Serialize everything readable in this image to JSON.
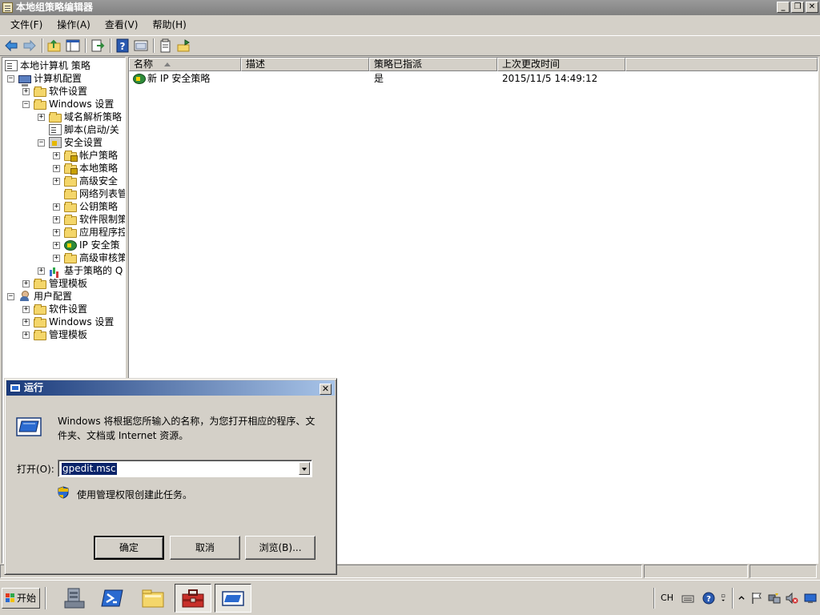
{
  "window": {
    "title": "本地组策略编辑器",
    "controls": {
      "minimize": "_",
      "maximize": "❐",
      "close": "✕"
    }
  },
  "menu": [
    "文件(F)",
    "操作(A)",
    "查看(V)",
    "帮助(H)"
  ],
  "toolbar_icons": [
    "back-icon",
    "forward-icon",
    "up-folder-icon",
    "show-hide-tree-icon",
    "export-list-icon",
    "help-icon",
    "console-icon",
    "properties-icon",
    "action-icon"
  ],
  "tree": {
    "root": "本地计算机 策略",
    "computer_config": "计算机配置",
    "software_settings": "软件设置",
    "windows_settings": "Windows 设置",
    "name_resolution": "域名解析策略",
    "scripts": "脚本(启动/关",
    "security_settings": "安全设置",
    "account_policy": "帐户策略",
    "local_policy": "本地策略",
    "advanced_security": "高级安全",
    "network_list": "网络列表管",
    "public_key": "公钥策略",
    "software_restriction": "软件限制策",
    "app_control": "应用程序控",
    "ip_security": "IP 安全策",
    "advanced_audit": "高级审核策",
    "qos": "基于策略的 Q",
    "admin_templates": "管理模板",
    "user_config": "用户配置",
    "user_software": "软件设置",
    "user_windows": "Windows 设置",
    "user_admin_templates": "管理模板"
  },
  "list": {
    "headers": [
      "名称",
      "描述",
      "策略已指派",
      "上次更改时间"
    ],
    "rows": [
      {
        "name": "新 IP 安全策略",
        "description": "",
        "assigned": "是",
        "modified": "2015/11/5 14:49:12"
      }
    ]
  },
  "taskbar": {
    "start": "开始",
    "tray": {
      "lang": "CH"
    }
  },
  "run_dialog": {
    "title": "运行",
    "close": "✕",
    "description": "Windows 将根据您所输入的名称，为您打开相应的程序、文件夹、文档或 Internet 资源。",
    "open_label": "打开(O):",
    "input_value": "gpedit.msc",
    "admin_note": "使用管理权限创建此任务。",
    "ok": "确定",
    "cancel": "取消",
    "browse": "浏览(B)..."
  },
  "colors": {
    "face": "#d4d0c8",
    "title_gradient_start": "#1a3a7a",
    "title_gradient_end": "#a8c4e8",
    "selection": "#0a246a"
  }
}
